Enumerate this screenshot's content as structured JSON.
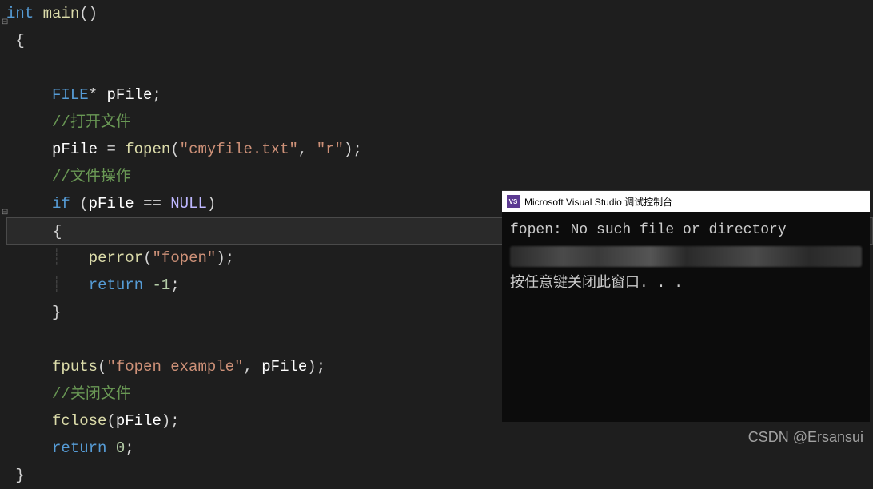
{
  "code": {
    "l1": {
      "type": "int",
      "func": "main",
      "parens": "()"
    },
    "l2": "{",
    "l4_type": "FILE",
    "l4_star": "*",
    "l4_var": "pFile",
    "l5_comment": "//打开文件",
    "l6_var": "pFile",
    "l6_eq": "=",
    "l6_func": "fopen",
    "l6_str1": "\"cmyfile.txt\"",
    "l6_str2": "\"r\"",
    "l7_comment": "//文件操作",
    "l8_if": "if",
    "l8_var": "pFile",
    "l8_eq": "==",
    "l8_null": "NULL",
    "l9": "{",
    "l10_func": "perror",
    "l10_str": "\"fopen\"",
    "l11_ret": "return",
    "l11_num": "-1",
    "l12": "}",
    "l14_func": "fputs",
    "l14_str": "\"fopen example\"",
    "l14_var": "pFile",
    "l15_comment": "//关闭文件",
    "l16_func": "fclose",
    "l16_var": "pFile",
    "l17_ret": "return",
    "l17_num": "0",
    "l18": "}"
  },
  "console": {
    "title": "Microsoft Visual Studio 调试控制台",
    "line1": "fopen: No such file or directory",
    "line3": "按任意键关闭此窗口. . ."
  },
  "watermark": "CSDN @Ersansui"
}
